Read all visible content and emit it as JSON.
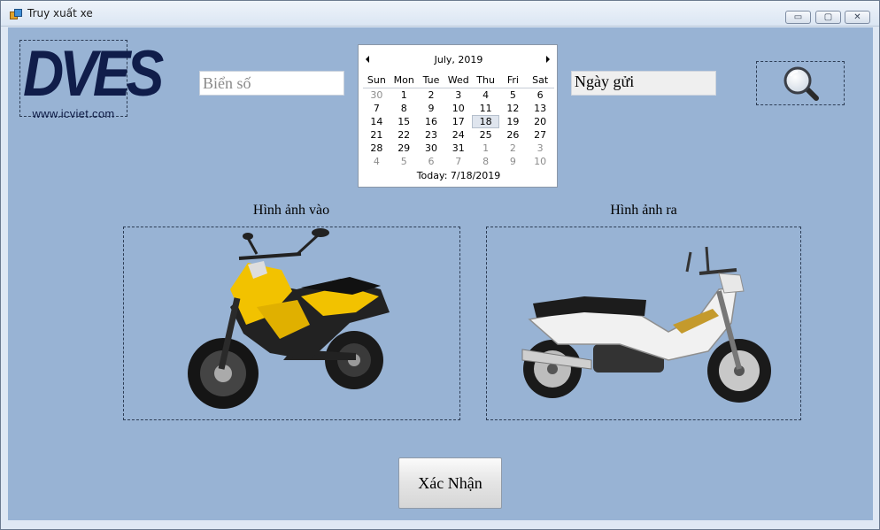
{
  "window": {
    "title": "Truy xuất xe",
    "controls": {
      "minimize": "▭",
      "maximize": "▢",
      "close": "✕"
    }
  },
  "logo": {
    "text": "DVES",
    "url": "www.icviet.com"
  },
  "plate_input": {
    "placeholder": "Biển số",
    "value": ""
  },
  "date_field": {
    "value": "Ngày gửi"
  },
  "calendar": {
    "month_label": "July, 2019",
    "weekdays": [
      "Sun",
      "Mon",
      "Tue",
      "Wed",
      "Thu",
      "Fri",
      "Sat"
    ],
    "weeks": [
      [
        "30",
        "1",
        "2",
        "3",
        "4",
        "5",
        "6"
      ],
      [
        "7",
        "8",
        "9",
        "10",
        "11",
        "12",
        "13"
      ],
      [
        "14",
        "15",
        "16",
        "17",
        "18",
        "19",
        "20"
      ],
      [
        "21",
        "22",
        "23",
        "24",
        "25",
        "26",
        "27"
      ],
      [
        "28",
        "29",
        "30",
        "31",
        "1",
        "2",
        "3"
      ],
      [
        "4",
        "5",
        "6",
        "7",
        "8",
        "9",
        "10"
      ]
    ],
    "selected_day": "18",
    "today_label": "Today: 7/18/2019"
  },
  "images": {
    "in_caption": "Hình ảnh vào",
    "out_caption": "Hình ảnh ra"
  },
  "confirm_button": {
    "label": "Xác Nhận"
  },
  "colors": {
    "client_bg": "#98b3d4",
    "bike_in_accent": "#f2c200",
    "bike_out_body": "#f1f1f1"
  }
}
